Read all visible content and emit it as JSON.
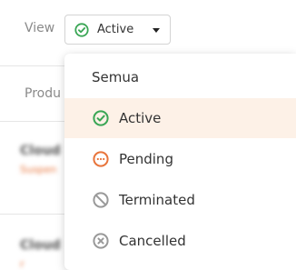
{
  "toolbar": {
    "view_label": "View",
    "select_value": "Active"
  },
  "table": {
    "column_header": "Produ",
    "rows": [
      {
        "title": "Cloud",
        "sub": "Suspen"
      },
      {
        "title": "Cloud",
        "sub": "r"
      }
    ]
  },
  "menu": {
    "items": [
      {
        "label": "Semua",
        "icon": "none"
      },
      {
        "label": "Active",
        "icon": "check-circle-icon",
        "color": "#3aa655"
      },
      {
        "label": "Pending",
        "icon": "dots-circle-icon",
        "color": "#e8743b"
      },
      {
        "label": "Terminated",
        "icon": "ban-icon",
        "color": "#999999"
      },
      {
        "label": "Cancelled",
        "icon": "x-circle-icon",
        "color": "#999999"
      }
    ],
    "selected_index": 1,
    "selected_background": "#fdf1e7"
  }
}
